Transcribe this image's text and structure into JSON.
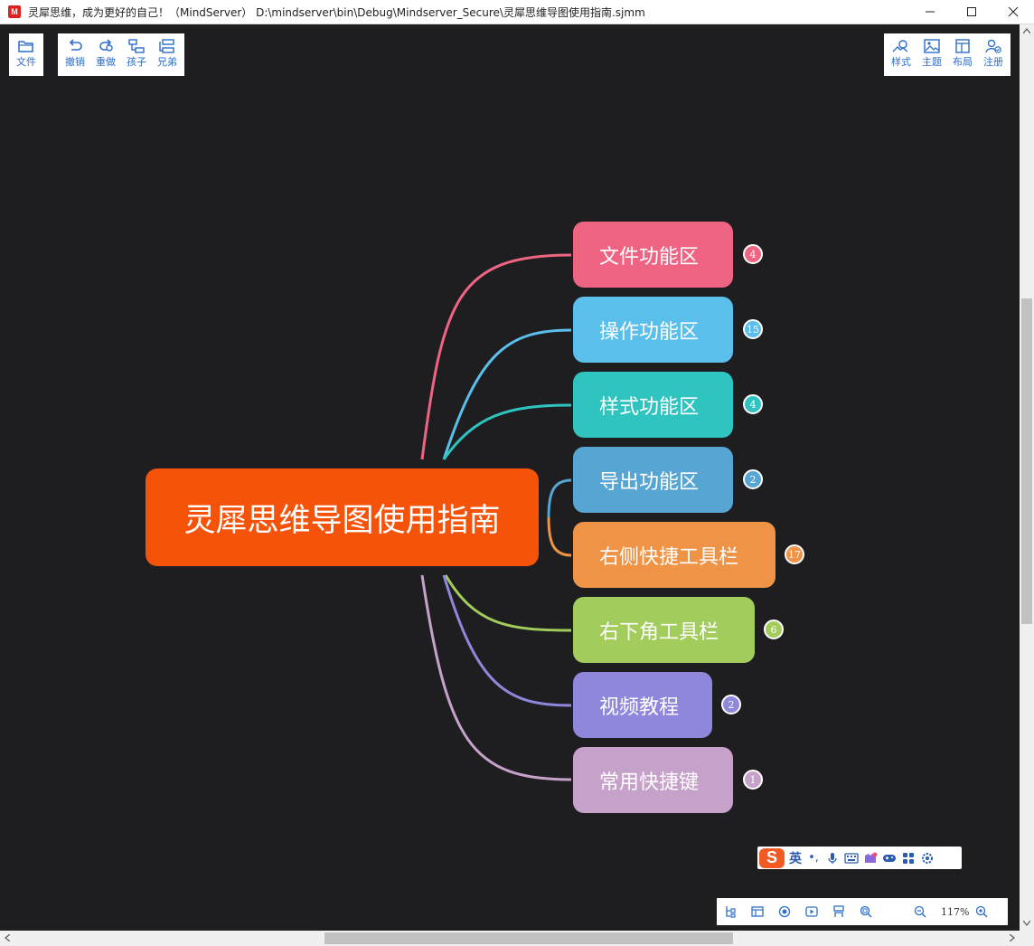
{
  "window": {
    "title": "灵犀思维，成为更好的自己！（MindServer）   D:\\mindserver\\bin\\Debug\\Mindserver_Secure\\灵犀思维导图使用指南.sjmm",
    "icon_letter": "M"
  },
  "toolbar_left": {
    "file": "文件",
    "undo": "撤销",
    "redo": "重做",
    "child": "孩子",
    "sibling": "兄弟"
  },
  "toolbar_right": {
    "style": "样式",
    "theme": "主题",
    "layout": "布局",
    "register": "注册"
  },
  "mindmap": {
    "root": "灵犀思维导图使用指南",
    "branches": [
      {
        "label": "文件功能区",
        "count": "4",
        "color": "#ef6483"
      },
      {
        "label": "操作功能区",
        "count": "15",
        "color": "#5bbfec"
      },
      {
        "label": "样式功能区",
        "count": "4",
        "color": "#2fc4c0"
      },
      {
        "label": "导出功能区",
        "count": "2",
        "color": "#57a5d2"
      },
      {
        "label": "右侧快捷工具栏",
        "count": "17",
        "color": "#ef9447"
      },
      {
        "label": "右下角工具栏",
        "count": "6",
        "color": "#a2cd5d"
      },
      {
        "label": "视频教程",
        "count": "2",
        "color": "#8f87dc"
      },
      {
        "label": "常用快捷键",
        "count": "1",
        "color": "#c6a1c9"
      }
    ]
  },
  "ime": {
    "logo": "S",
    "lang": "英",
    "punct": "•,"
  },
  "bottom_toolbar": {
    "zoom": "117%"
  }
}
